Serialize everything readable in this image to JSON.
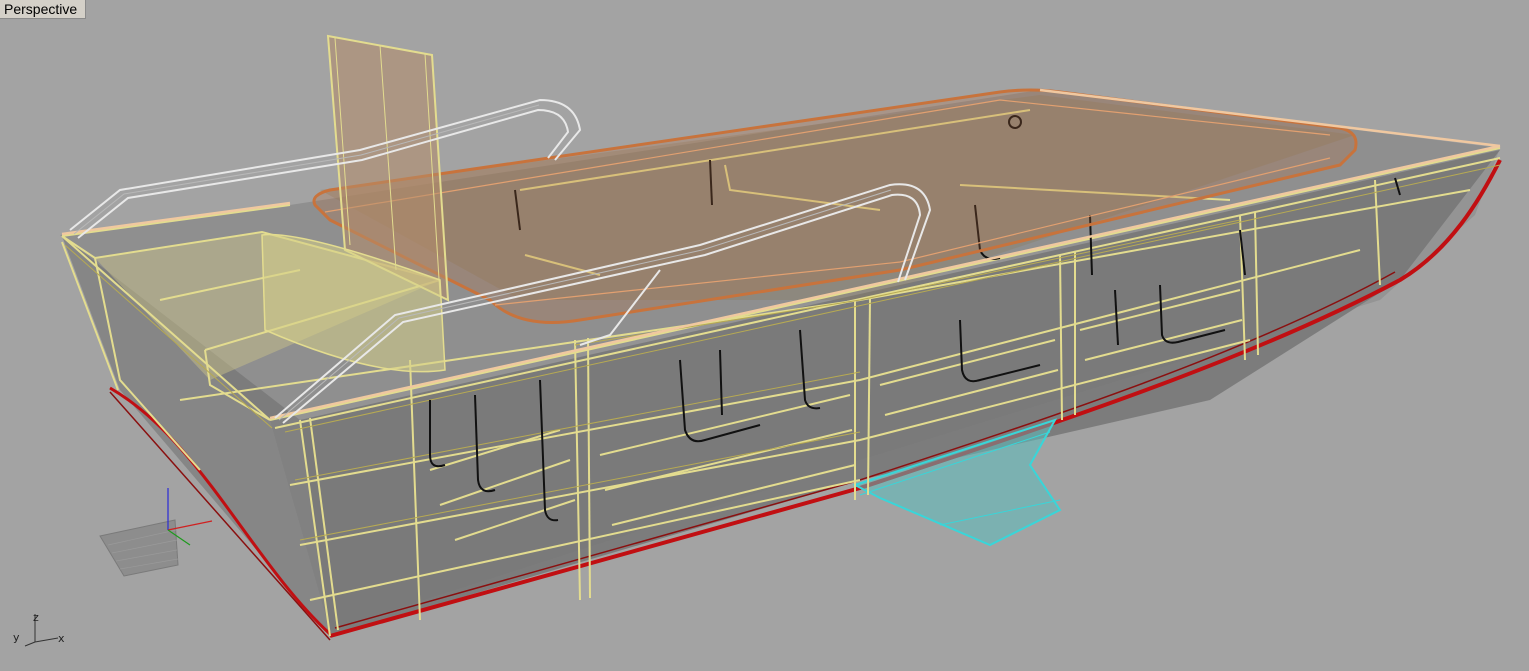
{
  "viewport": {
    "title": "Perspective",
    "background": "#a3a3a3"
  },
  "axes_widget": {
    "x_label": "x",
    "y_label": "y",
    "z_label": "z"
  },
  "scene": {
    "object": "boat hull wireframe model",
    "colors": {
      "frame": "#e3dc8f",
      "frame_dark": "#b7aa52",
      "hull_edge": "#c10f12",
      "gunwale": "#c8733c",
      "rail": "#e8e8e8",
      "keel_fin": "#38d6d9",
      "panel": "#5d5d5d"
    }
  }
}
